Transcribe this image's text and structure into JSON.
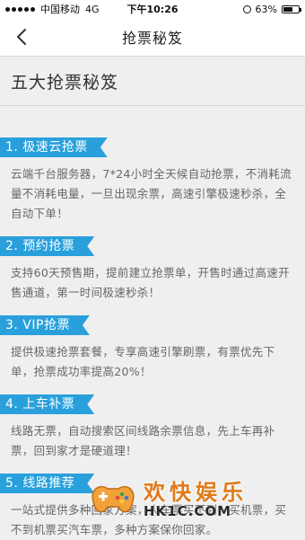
{
  "status_bar": {
    "carrier": "中国移动",
    "network": "4G",
    "time": "下午10:26",
    "battery": "63%",
    "battery_level": 0.63
  },
  "nav": {
    "title": "抢票秘笈"
  },
  "page": {
    "title": "五大抢票秘笈"
  },
  "sections": [
    {
      "heading": "1. 极速云抢票",
      "body": "云端千台服务器，7*24小时全天候自动抢票，不消耗流量不消耗电量，一旦出现余票，高速引擎极速秒杀，全自动下单！"
    },
    {
      "heading": "2. 预约抢票",
      "body": "支持60天预售期，提前建立抢票单，开售时通过高速开售通道，第一时间极速秒杀！"
    },
    {
      "heading": "3. VIP抢票",
      "body": "提供极速抢票套餐，专享高速引擎刷票，有票优先下单，抢票成功率提高20%！"
    },
    {
      "heading": "4. 上车补票",
      "body": "线路无票，自动搜索区间线路余票信息，先上车再补票，回到家才是硬道理！"
    },
    {
      "heading": "5. 线路推荐",
      "body": "一站式提供多种回家方案，火车票买不到？买机票，买不到机票买汽车票，多种方案保你回家。"
    }
  ],
  "watermark": {
    "text": "欢快娱乐",
    "sub": "HK1C.COM"
  },
  "colors": {
    "accent": "#29a0dc",
    "background": "#efefef",
    "watermark": "#e07a1a"
  }
}
